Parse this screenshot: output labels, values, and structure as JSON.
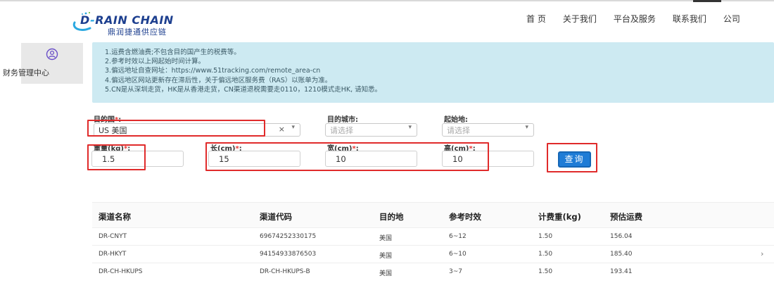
{
  "brand": {
    "logo_main_left": "D",
    "logo_main_dash": "-",
    "logo_main_right": "RAIN CHAIN",
    "logo_sub": "鼎润捷通供应链",
    "colors": {
      "primary": "#1d3f8f",
      "accent": "#2aa8e0"
    }
  },
  "nav": {
    "items": [
      "首 页",
      "关于我们",
      "平台及服务",
      "联系我们",
      "公司"
    ]
  },
  "sidebar": {
    "item_label": "财务管理中心",
    "item_icon": "user-circle-icon"
  },
  "notice": {
    "lines": [
      "1.运费含燃油费;不包含目的国产生的税费等。",
      "2.参考时效以上网起始时间计算。",
      "3.偏远地址自查网址：https://www.51tracking.com/remote_area-cn",
      "4.偏远地区网站更新存在滞后性，关于偏远地区服务费（RAS）以账单为准。",
      "5.CN是从深圳走货，HK是从香港走货，CN渠道退税需要走0110，1210模式走HK, 请知悉。"
    ]
  },
  "form": {
    "destination_country": {
      "label": "目的国",
      "required": "*",
      "colon": ":",
      "value": "US 美国",
      "clear": "×",
      "arrow": "▾"
    },
    "destination_city": {
      "label": "目的城市:",
      "placeholder": "请选择",
      "arrow": "▾"
    },
    "origin": {
      "label": "起始地:",
      "placeholder": "请选择",
      "arrow": "▾"
    },
    "weight": {
      "label": "重量(kg)",
      "required": "*",
      "colon": ":",
      "value": "1.5"
    },
    "length": {
      "label": "长(cm)",
      "required": "*",
      "colon": ":",
      "value": "15"
    },
    "width": {
      "label": "宽(cm)",
      "required": "*",
      "colon": ":",
      "value": "10"
    },
    "height": {
      "label": "高(cm)",
      "required": "*",
      "colon": ":",
      "value": "10"
    },
    "query_button": "查询"
  },
  "table": {
    "headers": [
      "渠道名称",
      "渠道代码",
      "目的地",
      "参考时效",
      "计费重(kg)",
      "预估运费"
    ],
    "rows": [
      [
        "DR-CNYT",
        "69674252330175",
        "美国",
        "6~12",
        "1.50",
        "156.04"
      ],
      [
        "DR-HKYT",
        "94154933876503",
        "美国",
        "6~10",
        "1.50",
        "185.40"
      ],
      [
        "DR-CH-HKUPS",
        "DR-CH-HKUPS-B",
        "美国",
        "3~7",
        "1.50",
        "193.41"
      ]
    ],
    "row_chevron": "›"
  }
}
